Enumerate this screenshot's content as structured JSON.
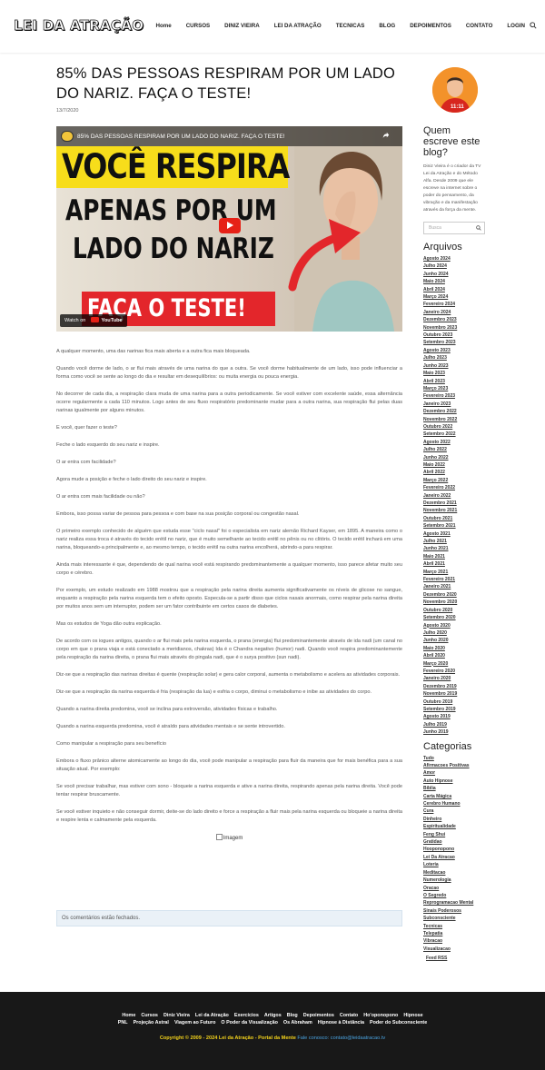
{
  "header": {
    "logo": "LEI DA ATRAÇÃO",
    "nav": [
      "Home",
      "CURSOS",
      "DINIZ VIEIRA",
      "LEI DA ATRAÇÃO",
      "TECNICAS",
      "BLOG",
      "DEPOIMENTOS",
      "CONTATO",
      "LOGIN"
    ]
  },
  "post": {
    "title": "85% DAS PESSOAS RESPIRAM POR UM LADO DO NARIZ. FAÇA O TESTE!",
    "date": "13/7/2020",
    "video": {
      "bar_title": "85% DAS PESSOAS RESPIRAM POR UM LADO DO NARIZ. FAÇA O TESTE!",
      "line1": "VOCÊ RESPIRA",
      "line2": "APENAS POR UM",
      "line3": "LADO DO NARIZ",
      "line4": "FAÇA O TESTE!",
      "watch_on": "Watch on",
      "youtube": "YouTube"
    },
    "paragraphs": [
      "A qualquer momento, uma das narinas fica mais aberta e a outra fica mais bloqueada.",
      "Quando você dorme de lado, o ar flui mais através de uma narina do que a outra. Se você dorme habitualmente de um lado, isso pode influenciar a forma como você se sente ao longo do dia e resultar em desequilíbrios: ou muita energia ou pouca energia.",
      "No decorrer de cada dia, a respiração clara muda de uma narina para a outra periodicamente. Se você estiver com excelente saúde, essa alternância ocorre regularmente a cada 110 minutos. Logo antes de seu fluxo respiratório predominante mudar para a outra narina, sua respiração flui pelas duas narinas igualmente por alguns minutos.",
      "E você, quer fazer o teste?",
      "Feche o lado esquerdo do seu nariz e inspire.",
      "O ar entra com facilidade?",
      "Agora mude a posição e feche o lado direito do seu nariz e inspire.",
      "O ar entra com mais facilidade ou não?",
      "Embora, isso possa variar de pessoa para pessoa e com base na sua posição corporal ou congestão nasal.",
      "O primeiro exemplo conhecido de alguém que estuda esse \"ciclo nasal\" foi o especialista em nariz alemão Richard Kayser, em 1895. A maneira como o nariz realiza essa troca é através do tecido erétil no nariz, que é muito semelhante ao tecido erétil no pênis ou no clitóris. O tecido erétil inchará em uma narina, bloqueando-a principalmente e, ao mesmo tempo, o tecido erétil na outra narina encolherá, abrindo-a para respirar.",
      "Ainda mais interessante é que, dependendo de qual narina você está respirando predominantemente a qualquer momento, isso parece afetar muito seu corpo e cérebro.",
      "Por exemplo, um estudo realizado em 1988 mostrou que a respiração pela narina direita aumenta significativamente os níveis de glicose no sangue, enquanto a respiração pela narina esquerda tem o efeito oposto. Especula-se a partir disso que ciclos nasais anormais, como respirar pela narina direita por muitos anos sem um interruptor, podem ser um fator contribuinte em certos casos de diabetes.",
      "Mas os estudos de Yoga dão outra explicação.",
      "De acordo com os iogues antigos, quando o ar flui mais pela narina esquerda, o prana (energia) flui predominantemente através de ida nadi (um canal no corpo em que o prana viaja e está conectado a meridianos, chakras) Ida é o Chandra negativo (humor) nadi. Quando você respira predominantemente pela respiração da narina direita, o prana flui mais através do pingala nadi, que é o surya positivo (sun nadi).",
      "Diz-se que a respiração das narinas direitas é quente (respiração solar) e gera calor corporal, aumenta o metabolismo e acelera as atividades corporais.",
      "Diz-se que a respiração da narina esquerda é fria (respiração da lua) e esfria o corpo, diminui o metabolismo e inibe as atividades do corpo.",
      "Quando a narina direita predomina, você se inclina para extroversão, atividades físicas e trabalho.",
      "Quando a narina esquerda predomina, você é atraído para atividades mentais e se sente introvertido.",
      "Como manipular a respiração para seu benefício",
      "Embora o fluxo prânico alterne atomicamente ao longo do dia, você pode manipular a respiração para fluir da maneira que for mais benéfica para a sua situação atual. Por exemplo:",
      "Se você precisar trabalhar, mas estiver com sono - bloqueie a narina esquerda e ative a narina direita, respirando apenas pela narina direita. Você pode tentar respirar bruscamente.",
      "Se você estiver inquieto e não conseguir dormir, deite-se do lado direito e force a respiração a fluir mais pela narina esquerda ou bloqueie a narina direita e respire lenta e calmamente pela esquerda."
    ],
    "image_alt": "Imagem",
    "comments_closed": "Os comentários estão fechados."
  },
  "sidebar": {
    "author_heading": "Quem escreve este blog?",
    "about": "Diniz Vieira é o criador da TV Lei da Atração e do Método Alfa. Desde 2009 que ele escreve na internet sobre o poder do pensamento, da vibração e da manifestação através da força da mente.",
    "search_placeholder": "Busca",
    "archives_heading": "Arquivos",
    "archives": [
      "Agosto 2024",
      "Julho 2024",
      "Junho 2024",
      "Maio 2024",
      "Abril 2024",
      "Março 2024",
      "Fevereiro 2024",
      "Janeiro 2024",
      "Dezembro 2023",
      "Novembro 2023",
      "Outubro 2023",
      "Setembro 2023",
      "Agosto 2023",
      "Julho 2023",
      "Junho 2023",
      "Maio 2023",
      "Abril 2023",
      "Março 2023",
      "Fevereiro 2023",
      "Janeiro 2023",
      "Dezembro 2022",
      "Novembro 2022",
      "Outubro 2022",
      "Setembro 2022",
      "Agosto 2022",
      "Julho 2022",
      "Junho 2022",
      "Maio 2022",
      "Abril 2022",
      "Março 2022",
      "Fevereiro 2022",
      "Janeiro 2022",
      "Dezembro 2021",
      "Novembro 2021",
      "Outubro 2021",
      "Setembro 2021",
      "Agosto 2021",
      "Julho 2021",
      "Junho 2021",
      "Maio 2021",
      "Abril 2021",
      "Março 2021",
      "Fevereiro 2021",
      "Janeiro 2021",
      "Dezembro 2020",
      "Novembro 2020",
      "Outubro 2020",
      "Setembro 2020",
      "Agosto 2020",
      "Julho 2020",
      "Junho 2020",
      "Maio 2020",
      "Abril 2020",
      "Março 2020",
      "Fevereiro 2020",
      "Janeiro 2020",
      "Dezembro 2019",
      "Novembro 2019",
      "Outubro 2019",
      "Setembro 2019",
      "Agosto 2019",
      "Julho 2019",
      "Junho 2019"
    ],
    "categories_heading": "Categorias",
    "categories": [
      "Tudo",
      "Afirmacoes Positivas",
      "Amor",
      "Auto Hipnose",
      "Bíblia",
      "Carta Mágica",
      "Cerebro Humano",
      "Cura",
      "Dinheiro",
      "Espiritualidade",
      "Feng Shui",
      "Gratidao",
      "Hooponopono",
      "Lei Da Atracao",
      "Loteria",
      "Meditacao",
      "Numerologia",
      "Oracao",
      "O Segredo",
      "Reprogramacao Mental",
      "Sinais Poderosos",
      "Subconsciente",
      "Tecnicas",
      "Telepatia",
      "Vibracao",
      "Visualizacao"
    ],
    "feed": "Feed RSS"
  },
  "footer": {
    "nav_row1": [
      "Home",
      "Cursos",
      "Diniz Vieira",
      "Lei da Atração",
      "Exercícios",
      "Artigos",
      "Blog",
      "Depoimentos",
      "Contato",
      "Ho'oponopono",
      "Hipnose"
    ],
    "nav_row2": [
      "PNL",
      "Projeção Astral",
      "Viagem ao Futuro",
      "O Poder da Visualização",
      "Os Abraham",
      "Hipnose à Distância",
      "Poder do Subconsciente"
    ],
    "copyright": "Copyright © 2009 - 2024 Lei da Atração - Portal da Mente",
    "contact": "Fale conosco: contato@leidaatracao.tv"
  },
  "colors": {
    "footer_bg": "#181818",
    "copyright": "#f3d21b",
    "contact_link": "#4aa3e0",
    "youtube_red": "#e62117"
  }
}
